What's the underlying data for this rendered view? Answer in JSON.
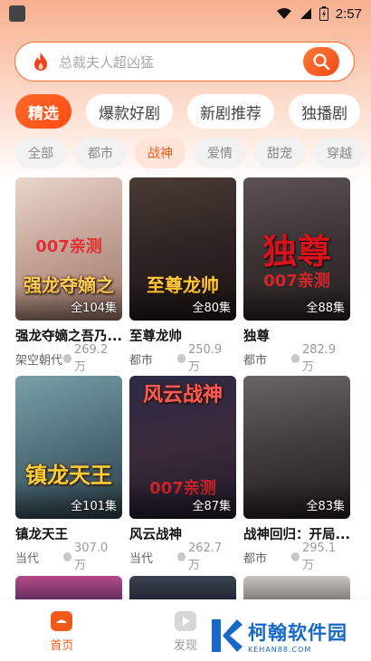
{
  "status_bar": {
    "time": "2:57"
  },
  "search": {
    "placeholder": "总裁夫人超凶猛"
  },
  "tabs": [
    {
      "label": "精选",
      "active": true
    },
    {
      "label": "爆款好剧",
      "active": false
    },
    {
      "label": "新剧推荐",
      "active": false
    },
    {
      "label": "独播剧",
      "active": false
    }
  ],
  "subtabs": [
    {
      "label": "全部",
      "active": false
    },
    {
      "label": "都市",
      "active": false
    },
    {
      "label": "战神",
      "active": true
    },
    {
      "label": "爱情",
      "active": false
    },
    {
      "label": "甜宠",
      "active": false
    },
    {
      "label": "穿越",
      "active": false
    }
  ],
  "dramas": [
    {
      "title": "强龙夺嫡之吾乃...",
      "genre": "架空朝代",
      "views": "269.2万",
      "episodes": "全104集",
      "poster_text": "强龙夺嫡之",
      "watermark": "007亲测"
    },
    {
      "title": "至尊龙帅",
      "genre": "都市",
      "views": "250.9万",
      "episodes": "全80集",
      "poster_text": "至尊龙帅",
      "watermark": ""
    },
    {
      "title": "独尊",
      "genre": "都市",
      "views": "282.9万",
      "episodes": "全88集",
      "poster_text": "独尊",
      "watermark": "007亲测"
    },
    {
      "title": "镇龙天王",
      "genre": "当代",
      "views": "307.0万",
      "episodes": "全101集",
      "poster_text": "镇龙天王",
      "watermark": ""
    },
    {
      "title": "风云战神",
      "genre": "当代",
      "views": "262.7万",
      "episodes": "全87集",
      "poster_text": "风云战神",
      "watermark": "007亲测"
    },
    {
      "title": "战神回归：开局...",
      "genre": "都市",
      "views": "295.1万",
      "episodes": "全83集",
      "poster_text": "",
      "watermark": ""
    }
  ],
  "bottom_nav": [
    {
      "label": "首页",
      "active": true
    },
    {
      "label": "发现",
      "active": false
    }
  ],
  "brand": {
    "name": "柯翰软件园",
    "url": "KEHAN88.COM"
  },
  "colors": {
    "accent": "#f25a1c",
    "brand_blue": "#1769c8"
  }
}
